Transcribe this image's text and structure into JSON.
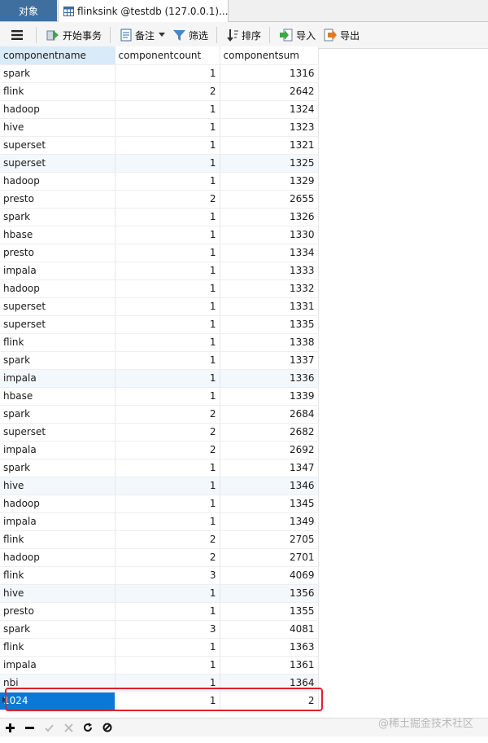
{
  "tabs": {
    "objects_label": "对象",
    "table_tab_label": "flinksink @testdb (127.0.0.1)..."
  },
  "toolbar": {
    "begin_transaction": "开始事务",
    "notes": "备注",
    "filter": "筛选",
    "sort": "排序",
    "import": "导入",
    "export": "导出"
  },
  "grid": {
    "columns": [
      "componentname",
      "componentcount",
      "componentsum"
    ],
    "rows": [
      [
        "spark",
        "1",
        "1316"
      ],
      [
        "flink",
        "2",
        "2642"
      ],
      [
        "hadoop",
        "1",
        "1324"
      ],
      [
        "hive",
        "1",
        "1323"
      ],
      [
        "superset",
        "1",
        "1321"
      ],
      [
        "superset",
        "1",
        "1325"
      ],
      [
        "hadoop",
        "1",
        "1329"
      ],
      [
        "presto",
        "2",
        "2655"
      ],
      [
        "spark",
        "1",
        "1326"
      ],
      [
        "hbase",
        "1",
        "1330"
      ],
      [
        "presto",
        "1",
        "1334"
      ],
      [
        "impala",
        "1",
        "1333"
      ],
      [
        "hadoop",
        "1",
        "1332"
      ],
      [
        "superset",
        "1",
        "1331"
      ],
      [
        "superset",
        "1",
        "1335"
      ],
      [
        "flink",
        "1",
        "1338"
      ],
      [
        "spark",
        "1",
        "1337"
      ],
      [
        "impala",
        "1",
        "1336"
      ],
      [
        "hbase",
        "1",
        "1339"
      ],
      [
        "spark",
        "2",
        "2684"
      ],
      [
        "superset",
        "2",
        "2682"
      ],
      [
        "impala",
        "2",
        "2692"
      ],
      [
        "spark",
        "1",
        "1347"
      ],
      [
        "hive",
        "1",
        "1346"
      ],
      [
        "hadoop",
        "1",
        "1345"
      ],
      [
        "impala",
        "1",
        "1349"
      ],
      [
        "flink",
        "2",
        "2705"
      ],
      [
        "hadoop",
        "2",
        "2701"
      ],
      [
        "flink",
        "3",
        "4069"
      ],
      [
        "hive",
        "1",
        "1356"
      ],
      [
        "presto",
        "1",
        "1355"
      ],
      [
        "spark",
        "3",
        "4081"
      ],
      [
        "flink",
        "1",
        "1363"
      ],
      [
        "impala",
        "1",
        "1361"
      ],
      [
        "nbi",
        "1",
        "1364"
      ],
      [
        "1024",
        "1",
        "2"
      ]
    ],
    "alt_rows": [
      5,
      17,
      23,
      29,
      34
    ],
    "selected_row": 35
  },
  "watermark": "@稀土掘金技术社区",
  "colors": {
    "objects_tab": "#3f6f9f",
    "selected_cell": "#0b78d7",
    "highlight_box": "#e0202a"
  }
}
